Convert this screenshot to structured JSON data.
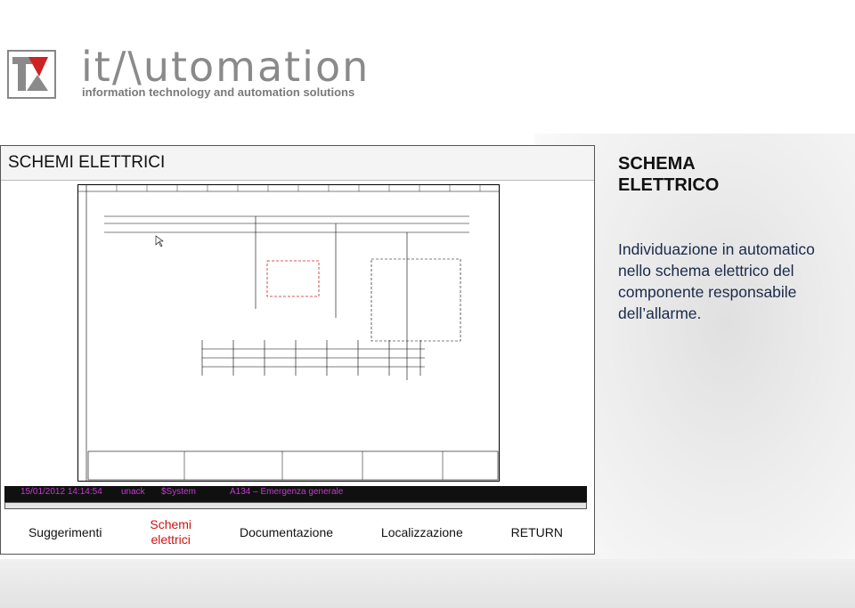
{
  "brand": {
    "name": "it/\\utomation",
    "tagline": "information technology and automation solutions"
  },
  "panel": {
    "title": "SCHEMI ELETTRICI"
  },
  "alarm": {
    "timestamp": "15/01/2012 14:14:54",
    "state": "unack",
    "source": "$System",
    "message": "A134 – Emergenza generale"
  },
  "nav": {
    "suggerimenti": "Suggerimenti",
    "schemi_line1": "Schemi",
    "schemi_line2": "elettrici",
    "documentazione": "Documentazione",
    "localizzazione": "Localizzazione",
    "return": "RETURN"
  },
  "side": {
    "title": "SCHEMA\nELETTRICO",
    "description": "Individuazione in automatico nello schema elettrico del componente responsabile dell’allarme."
  },
  "colors": {
    "alarm_text": "#c23ad0",
    "active_nav": "#cc1414",
    "logo_red": "#cc2222"
  }
}
